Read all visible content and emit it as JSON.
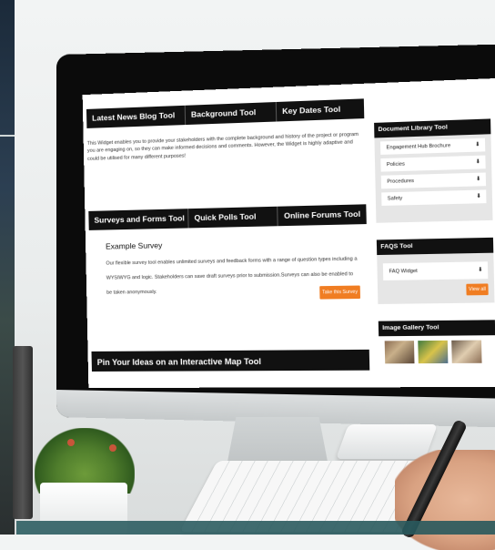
{
  "screen": {
    "top_tabs": [
      "Latest News Blog Tool",
      "Background Tool",
      "Key Dates Tool"
    ],
    "intro_text": "This Widget enables you to provide your stakeholders with the complete background and history of the project or program you are engaging on, so they can make informed decisions and comments. However, the Widget is highly adaptive and could be utilised for many different purposes!",
    "mid_tabs": [
      "Surveys and Forms Tool",
      "Quick Polls Tool",
      "Online Forums Tool"
    ],
    "survey": {
      "title": "Example Survey",
      "body": "Our flexible survey tool enables unlimited surveys and feedback forms with a range of question types including a WYSIWYG and logic. Stakeholders can save draft surveys prior to submission.Surveys can also be enabled to be taken anonymously.",
      "button": "Take this Survey"
    },
    "pin_bar": "Pin Your Ideas on an Interactive Map Tool",
    "document_library": {
      "title": "Document Library Tool",
      "items": [
        "Engagement Hub Brochure",
        "Policies",
        "Procedures",
        "Safety"
      ]
    },
    "faqs": {
      "title": "FAQS Tool",
      "item": "FAQ Widget",
      "view_all": "View all"
    },
    "gallery": {
      "title": "Image Gallery Tool"
    }
  },
  "icons": {
    "dropdown": "chevron-down-icon"
  },
  "colors": {
    "accent": "#f07d22",
    "header": "#111111",
    "panel": "#e6e6e6"
  }
}
